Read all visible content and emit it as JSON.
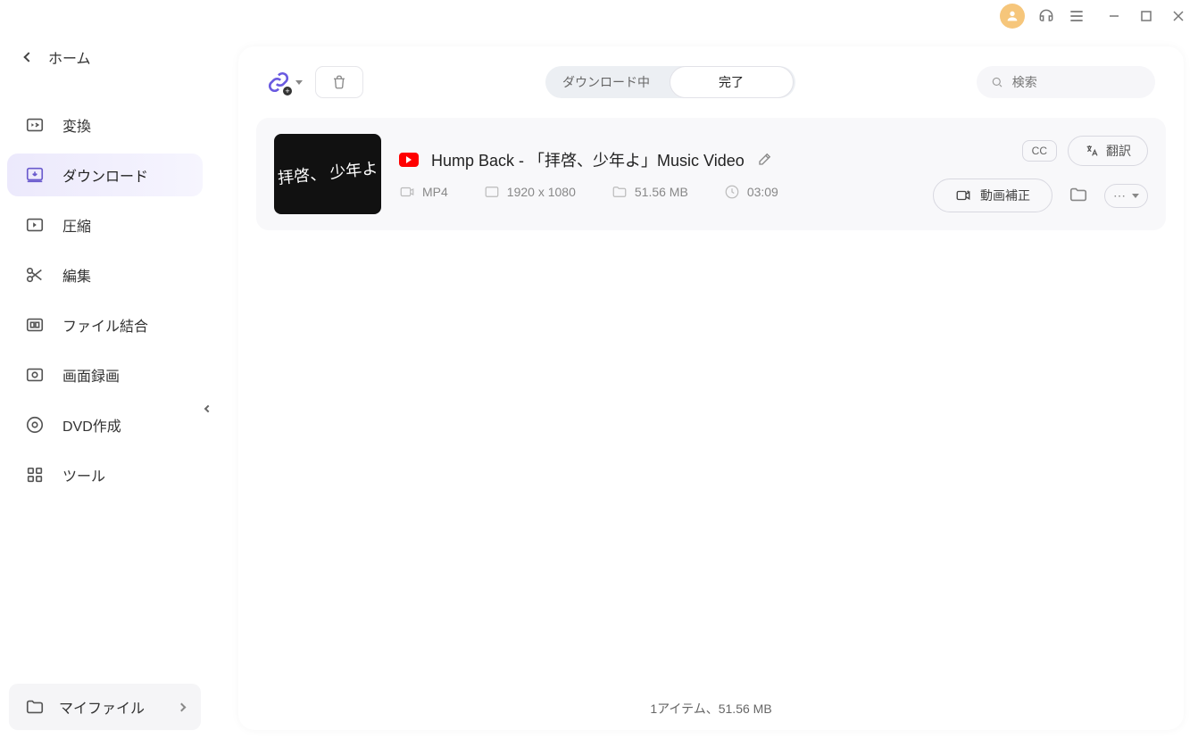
{
  "sidebar": {
    "home_label": "ホーム",
    "items": [
      {
        "label": "変換"
      },
      {
        "label": "ダウンロード"
      },
      {
        "label": "圧縮"
      },
      {
        "label": "編集"
      },
      {
        "label": "ファイル結合"
      },
      {
        "label": "画面録画"
      },
      {
        "label": "DVD作成"
      },
      {
        "label": "ツール"
      }
    ],
    "active_index": 1,
    "myfiles_label": "マイファイル"
  },
  "toolbar": {
    "tabs": {
      "downloading": "ダウンロード中",
      "completed": "完了"
    },
    "active_tab": "completed",
    "search_placeholder": "検索"
  },
  "items": [
    {
      "source": "youtube",
      "title": "Hump Back - 「拝啓、少年よ」Music Video",
      "thumb_text": "拝啓、\n少年よ",
      "format": "MP4",
      "resolution": "1920 x 1080",
      "size": "51.56 MB",
      "duration": "03:09",
      "cc_label": "CC",
      "translate_label": "翻訳",
      "enhance_label": "動画補正"
    }
  ],
  "footer_status": "1アイテム、51.56 MB"
}
